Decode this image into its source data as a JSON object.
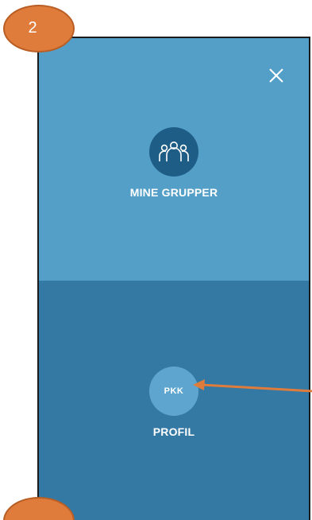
{
  "step_badge": {
    "number": "2"
  },
  "menu": {
    "close_icon": "close-icon",
    "groups": {
      "label": "MINE GRUPPER",
      "icon": "people-group-icon"
    },
    "profile": {
      "label": "PROFIL",
      "initials": "PKK"
    }
  },
  "colors": {
    "top_panel": "#549fc8",
    "bottom_panel": "#3479a4",
    "icon_circle": "#1e5e86",
    "avatar_circle": "#5ea6cf",
    "badge": "#e07c3b",
    "arrow": "#e07c3b"
  }
}
